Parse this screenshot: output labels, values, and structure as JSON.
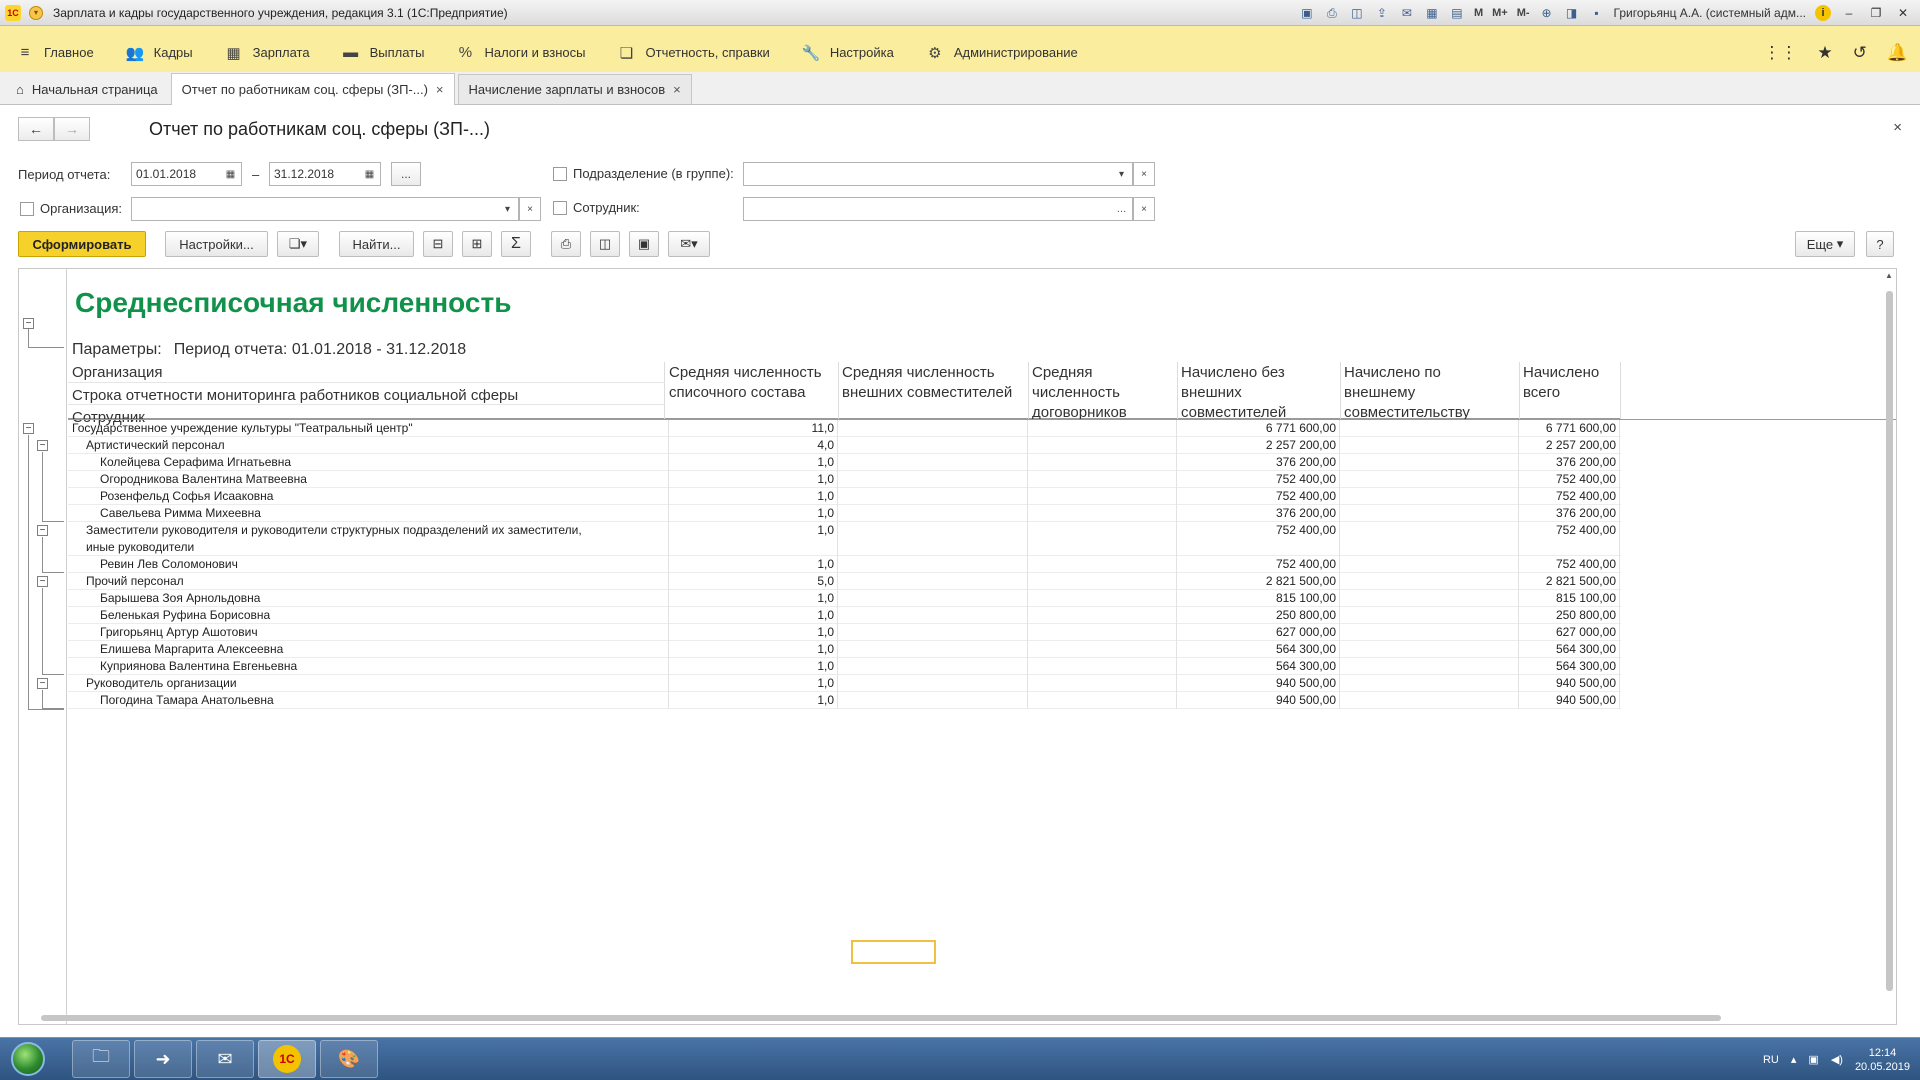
{
  "window": {
    "title": "Зарплата и кадры государственного учреждения, редакция 3.1  (1С:Предприятие)",
    "user": "Григорьянц А.А. (системный адм...",
    "mem_buttons": [
      "M",
      "M+",
      "M-"
    ]
  },
  "topmenu": {
    "items": [
      {
        "label": "Главное",
        "icon": "hamburger-icon"
      },
      {
        "label": "Кадры",
        "icon": "people-icon"
      },
      {
        "label": "Зарплата",
        "icon": "calculator-icon"
      },
      {
        "label": "Выплаты",
        "icon": "wallet-icon"
      },
      {
        "label": "Налоги и взносы",
        "icon": "percent-icon"
      },
      {
        "label": "Отчетность, справки",
        "icon": "documents-icon"
      },
      {
        "label": "Настройка",
        "icon": "wrench-icon"
      },
      {
        "label": "Администрирование",
        "icon": "gear-icon"
      }
    ]
  },
  "tabs": [
    {
      "label": "Начальная страница",
      "home": true
    },
    {
      "label": "Отчет по работникам соц. сферы (ЗП-...)",
      "active": true
    },
    {
      "label": "Начисление зарплаты и взносов"
    }
  ],
  "form": {
    "title": "Отчет по работникам соц. сферы (ЗП-...)",
    "period_label": "Период отчета:",
    "date_from": "01.01.2018",
    "date_sep": "–",
    "date_to": "31.12.2018",
    "ellipsis": "...",
    "org_label": "Организация:",
    "dept_label": "Подразделение (в группе):",
    "employee_label": "Сотрудник:",
    "generate_label": "Сформировать",
    "settings_label": "Настройки...",
    "find_label": "Найти...",
    "more_label": "Еще",
    "help_label": "?"
  },
  "report": {
    "title": "Среднесписочная численность",
    "params_label": "Параметры:",
    "params_value": "Период отчета: 01.01.2018 - 31.12.2018",
    "row_headers": [
      "Организация",
      "Строка отчетности мониторинга работников социальной сферы",
      "Сотрудник"
    ],
    "columns": [
      "Средняя численность списочного состава",
      "Средняя численность внешних совместителей",
      "Средняя численность договорников",
      "Начислено без внешних совместителей",
      "Начислено по внешнему совместительству",
      "Начислено всего"
    ],
    "rows": [
      {
        "name": "Государственное учреждение культуры \"Театральный центр\"",
        "level": 0,
        "avg": "11,0",
        "accrued": "6 771 600,00",
        "total": "6 771 600,00"
      },
      {
        "name": "Артистический персонал",
        "level": 1,
        "avg": "4,0",
        "accrued": "2 257 200,00",
        "total": "2 257 200,00"
      },
      {
        "name": "Колейцева Серафима Игнатьевна",
        "level": 2,
        "avg": "1,0",
        "accrued": "376 200,00",
        "total": "376 200,00"
      },
      {
        "name": "Огородникова Валентина Матвеевна",
        "level": 2,
        "avg": "1,0",
        "accrued": "752 400,00",
        "total": "752 400,00"
      },
      {
        "name": "Розенфельд Софья Исааковна",
        "level": 2,
        "avg": "1,0",
        "accrued": "752 400,00",
        "total": "752 400,00"
      },
      {
        "name": "Савельева Римма Михеевна",
        "level": 2,
        "avg": "1,0",
        "accrued": "376 200,00",
        "total": "376 200,00"
      },
      {
        "name": "Заместители руководителя и руководители структурных подразделений их заместители,",
        "name2": "иные руководители",
        "level": 1,
        "avg": "1,0",
        "accrued": "752 400,00",
        "total": "752 400,00"
      },
      {
        "name": "Ревин Лев Соломонович",
        "level": 2,
        "avg": "1,0",
        "accrued": "752 400,00",
        "total": "752 400,00"
      },
      {
        "name": "Прочий персонал",
        "level": 1,
        "avg": "5,0",
        "accrued": "2 821 500,00",
        "total": "2 821 500,00"
      },
      {
        "name": "Барышева Зоя Арнольдовна",
        "level": 2,
        "avg": "1,0",
        "accrued": "815 100,00",
        "total": "815 100,00"
      },
      {
        "name": "Беленькая Руфина Борисовна",
        "level": 2,
        "avg": "1,0",
        "accrued": "250 800,00",
        "total": "250 800,00"
      },
      {
        "name": "Григорьянц Артур Ашотович",
        "level": 2,
        "avg": "1,0",
        "accrued": "627 000,00",
        "total": "627 000,00"
      },
      {
        "name": "Елишева Маргарита Алексеевна",
        "level": 2,
        "avg": "1,0",
        "accrued": "564 300,00",
        "total": "564 300,00"
      },
      {
        "name": "Куприянова Валентина Евгеньевна",
        "level": 2,
        "avg": "1,0",
        "accrued": "564 300,00",
        "total": "564 300,00"
      },
      {
        "name": "Руководитель организации",
        "level": 1,
        "avg": "1,0",
        "accrued": "940 500,00",
        "total": "940 500,00"
      },
      {
        "name": "Погодина Тамара Анатольевна",
        "level": 2,
        "avg": "1,0",
        "accrued": "940 500,00",
        "total": "940 500,00"
      }
    ]
  },
  "taskbar": {
    "lang": "RU",
    "time": "12:14",
    "date": "20.05.2019"
  },
  "colors": {
    "menu_bg": "#fbed9e",
    "report_title": "#10924a",
    "primary_button": "#f6d12b"
  }
}
